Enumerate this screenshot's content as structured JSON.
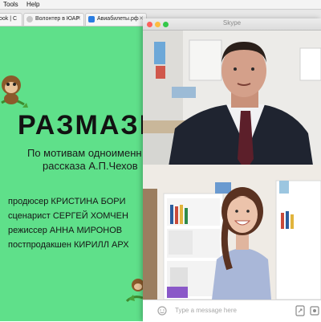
{
  "menubar": {
    "items": [
      "Tools",
      "Help"
    ]
  },
  "browser": {
    "tabs": [
      {
        "label": "ook | C",
        "icon": "facebook-icon",
        "color": "#3b5998"
      },
      {
        "label": "Волонтер в ЮАР",
        "icon": "globe-icon",
        "color": "#888888"
      },
      {
        "label": "Авиабилеты.рф",
        "icon": "plane-icon",
        "color": "#2a7de1"
      }
    ]
  },
  "slide": {
    "title": "РАЗМАЗН",
    "subtitle_lines": [
      "По мотивам одноименн",
      "рассказа А.П.Чехов"
    ],
    "credits": [
      "продюсер КРИСТИНА БОРИ",
      "сценарист СЕРГЕЙ ХОМЧЕН",
      "режиссер АННА МИРОНОВ",
      "постпродакшен КИРИЛЛ АРХ"
    ],
    "background_color": "#5fe08a"
  },
  "skype": {
    "title": "Skype",
    "chat_placeholder": "Type a message here"
  }
}
